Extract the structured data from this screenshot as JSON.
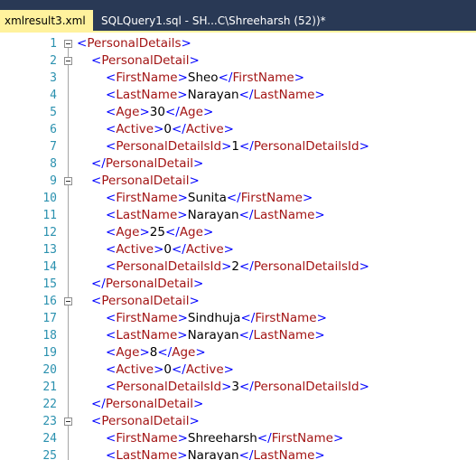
{
  "tabs": [
    {
      "label": "xmlresult3.xml",
      "active": true
    },
    {
      "label": "SQLQuery1.sql - SH...C\\Shreeharsh (52))*",
      "active": false
    }
  ],
  "colors": {
    "tab_strip": "#293955",
    "active_tab": "#fff29d",
    "line_number": "#2b91af",
    "xml_bracket": "#0000ff",
    "xml_tag": "#a31515",
    "xml_text": "#000000"
  },
  "icons": {
    "tab_close": "close-icon",
    "fold": "minus-box-icon"
  },
  "editor": {
    "lines": [
      {
        "num": "1",
        "fold": true,
        "indent": 0,
        "kind": "open",
        "tag": "PersonalDetails"
      },
      {
        "num": "2",
        "fold": true,
        "indent": 1,
        "kind": "open",
        "tag": "PersonalDetail"
      },
      {
        "num": "3",
        "fold": false,
        "indent": 2,
        "kind": "elem",
        "tag": "FirstName",
        "value": "Sheo"
      },
      {
        "num": "4",
        "fold": false,
        "indent": 2,
        "kind": "elem",
        "tag": "LastName",
        "value": "Narayan"
      },
      {
        "num": "5",
        "fold": false,
        "indent": 2,
        "kind": "elem",
        "tag": "Age",
        "value": "30"
      },
      {
        "num": "6",
        "fold": false,
        "indent": 2,
        "kind": "elem",
        "tag": "Active",
        "value": "0"
      },
      {
        "num": "7",
        "fold": false,
        "indent": 2,
        "kind": "elem",
        "tag": "PersonalDetailsId",
        "value": "1"
      },
      {
        "num": "8",
        "fold": false,
        "indent": 1,
        "kind": "close",
        "tag": "PersonalDetail"
      },
      {
        "num": "9",
        "fold": true,
        "indent": 1,
        "kind": "open",
        "tag": "PersonalDetail"
      },
      {
        "num": "10",
        "fold": false,
        "indent": 2,
        "kind": "elem",
        "tag": "FirstName",
        "value": "Sunita"
      },
      {
        "num": "11",
        "fold": false,
        "indent": 2,
        "kind": "elem",
        "tag": "LastName",
        "value": "Narayan"
      },
      {
        "num": "12",
        "fold": false,
        "indent": 2,
        "kind": "elem",
        "tag": "Age",
        "value": "25"
      },
      {
        "num": "13",
        "fold": false,
        "indent": 2,
        "kind": "elem",
        "tag": "Active",
        "value": "0"
      },
      {
        "num": "14",
        "fold": false,
        "indent": 2,
        "kind": "elem",
        "tag": "PersonalDetailsId",
        "value": "2"
      },
      {
        "num": "15",
        "fold": false,
        "indent": 1,
        "kind": "close",
        "tag": "PersonalDetail"
      },
      {
        "num": "16",
        "fold": true,
        "indent": 1,
        "kind": "open",
        "tag": "PersonalDetail"
      },
      {
        "num": "17",
        "fold": false,
        "indent": 2,
        "kind": "elem",
        "tag": "FirstName",
        "value": "Sindhuja"
      },
      {
        "num": "18",
        "fold": false,
        "indent": 2,
        "kind": "elem",
        "tag": "LastName",
        "value": "Narayan"
      },
      {
        "num": "19",
        "fold": false,
        "indent": 2,
        "kind": "elem",
        "tag": "Age",
        "value": "8"
      },
      {
        "num": "20",
        "fold": false,
        "indent": 2,
        "kind": "elem",
        "tag": "Active",
        "value": "0"
      },
      {
        "num": "21",
        "fold": false,
        "indent": 2,
        "kind": "elem",
        "tag": "PersonalDetailsId",
        "value": "3"
      },
      {
        "num": "22",
        "fold": false,
        "indent": 1,
        "kind": "close",
        "tag": "PersonalDetail"
      },
      {
        "num": "23",
        "fold": true,
        "indent": 1,
        "kind": "open",
        "tag": "PersonalDetail"
      },
      {
        "num": "24",
        "fold": false,
        "indent": 2,
        "kind": "elem",
        "tag": "FirstName",
        "value": "Shreeharsh"
      },
      {
        "num": "25",
        "fold": false,
        "indent": 2,
        "kind": "elem",
        "tag": "LastName",
        "value": "Narayan"
      }
    ]
  }
}
